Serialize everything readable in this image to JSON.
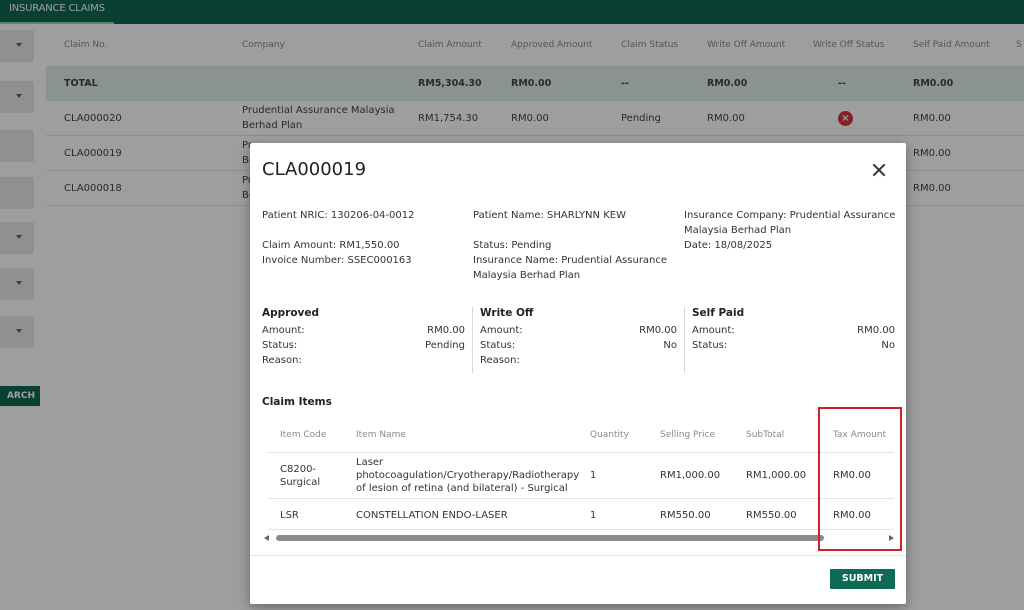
{
  "app": {
    "tab_label": "INSURANCE CLAIMS"
  },
  "filters": {
    "search_label": "ARCH"
  },
  "table": {
    "headers": {
      "claim_no": "Claim No.",
      "company": "Company",
      "claim_amount": "Claim Amount",
      "approved_amount": "Approved Amount",
      "claim_status": "Claim Status",
      "write_off_amount": "Write Off Amount",
      "write_off_status": "Write Off Status",
      "self_paid_amount": "Self Paid Amount",
      "extra": "S"
    },
    "total": {
      "label": "TOTAL",
      "claim_amount": "RM5,304.30",
      "approved_amount": "RM0.00",
      "claim_status": "--",
      "write_off_amount": "RM0.00",
      "write_off_status": "--",
      "self_paid_amount": "RM0.00"
    },
    "rows": [
      {
        "claim_no": "CLA000020",
        "company_line1": "Prudential Assurance Malaysia",
        "company_line2": "Berhad Plan",
        "claim_amount": "RM1,754.30",
        "approved_amount": "RM0.00",
        "claim_status": "Pending",
        "write_off_amount": "RM0.00",
        "self_paid_amount": "RM0.00"
      },
      {
        "claim_no": "CLA000019",
        "company_line1": "Pr",
        "company_line2": "Be",
        "self_paid_amount": "RM0.00"
      },
      {
        "claim_no": "CLA000018",
        "company_line1": "Pr",
        "company_line2": "Be",
        "self_paid_amount": "RM0.00"
      }
    ]
  },
  "modal": {
    "title": "CLA000019",
    "patient_nric": "Patient NRIC: 130206-04-0012",
    "patient_name": "Patient Name: SHARLYNN KEW",
    "insurance_company_line1": "Insurance Company: Prudential Assurance",
    "insurance_company_line2": "Malaysia Berhad Plan",
    "date": "Date: 18/08/2025",
    "claim_amount": "Claim Amount: RM1,550.00",
    "invoice_number": "Invoice Number: SSEC000163",
    "status": "Status: Pending",
    "insurance_name_line1": "Insurance Name: Prudential Assurance",
    "insurance_name_line2": "Malaysia Berhad Plan",
    "approved": {
      "title": "Approved",
      "amount_label": "Amount:",
      "amount": "RM0.00",
      "status_label": "Status:",
      "status": "Pending",
      "reason_label": "Reason:"
    },
    "write_off": {
      "title": "Write Off",
      "amount_label": "Amount:",
      "amount": "RM0.00",
      "status_label": "Status:",
      "status": "No",
      "reason_label": "Reason:"
    },
    "self_paid": {
      "title": "Self Paid",
      "amount_label": "Amount:",
      "amount": "RM0.00",
      "status_label": "Status:",
      "status": "No"
    },
    "claim_items": {
      "title": "Claim Items",
      "headers": {
        "item_code": "Item Code",
        "item_name": "Item Name",
        "quantity": "Quantity",
        "selling_price": "Selling Price",
        "subtotal": "SubTotal",
        "tax_amount": "Tax Amount"
      },
      "rows": [
        {
          "code_line1": "C8200-",
          "code_line2": "Surgical",
          "name_line1": "Laser",
          "name_line2": "photocoagulation/Cryotherapy/Radiotherapy",
          "name_line3": "of lesion of retina (and bilateral) - Surgical",
          "quantity": "1",
          "selling_price": "RM1,000.00",
          "subtotal": "RM1,000.00",
          "tax_amount": "RM0.00"
        },
        {
          "code_line1": "LSR",
          "name_line1": "CONSTELLATION ENDO-LASER",
          "quantity": "1",
          "selling_price": "RM550.00",
          "subtotal": "RM550.00",
          "tax_amount": "RM0.00"
        }
      ]
    },
    "submit_label": "SUBMIT"
  },
  "colors": {
    "brand_green": "#0e6a55",
    "total_row_bg": "#dfeee8",
    "error_red": "#d9363e",
    "highlight_red": "#d61c24"
  },
  "icons": {
    "close": "close-icon",
    "write_off_status": "x-circle-icon",
    "dropdown": "chevron-down-icon"
  }
}
